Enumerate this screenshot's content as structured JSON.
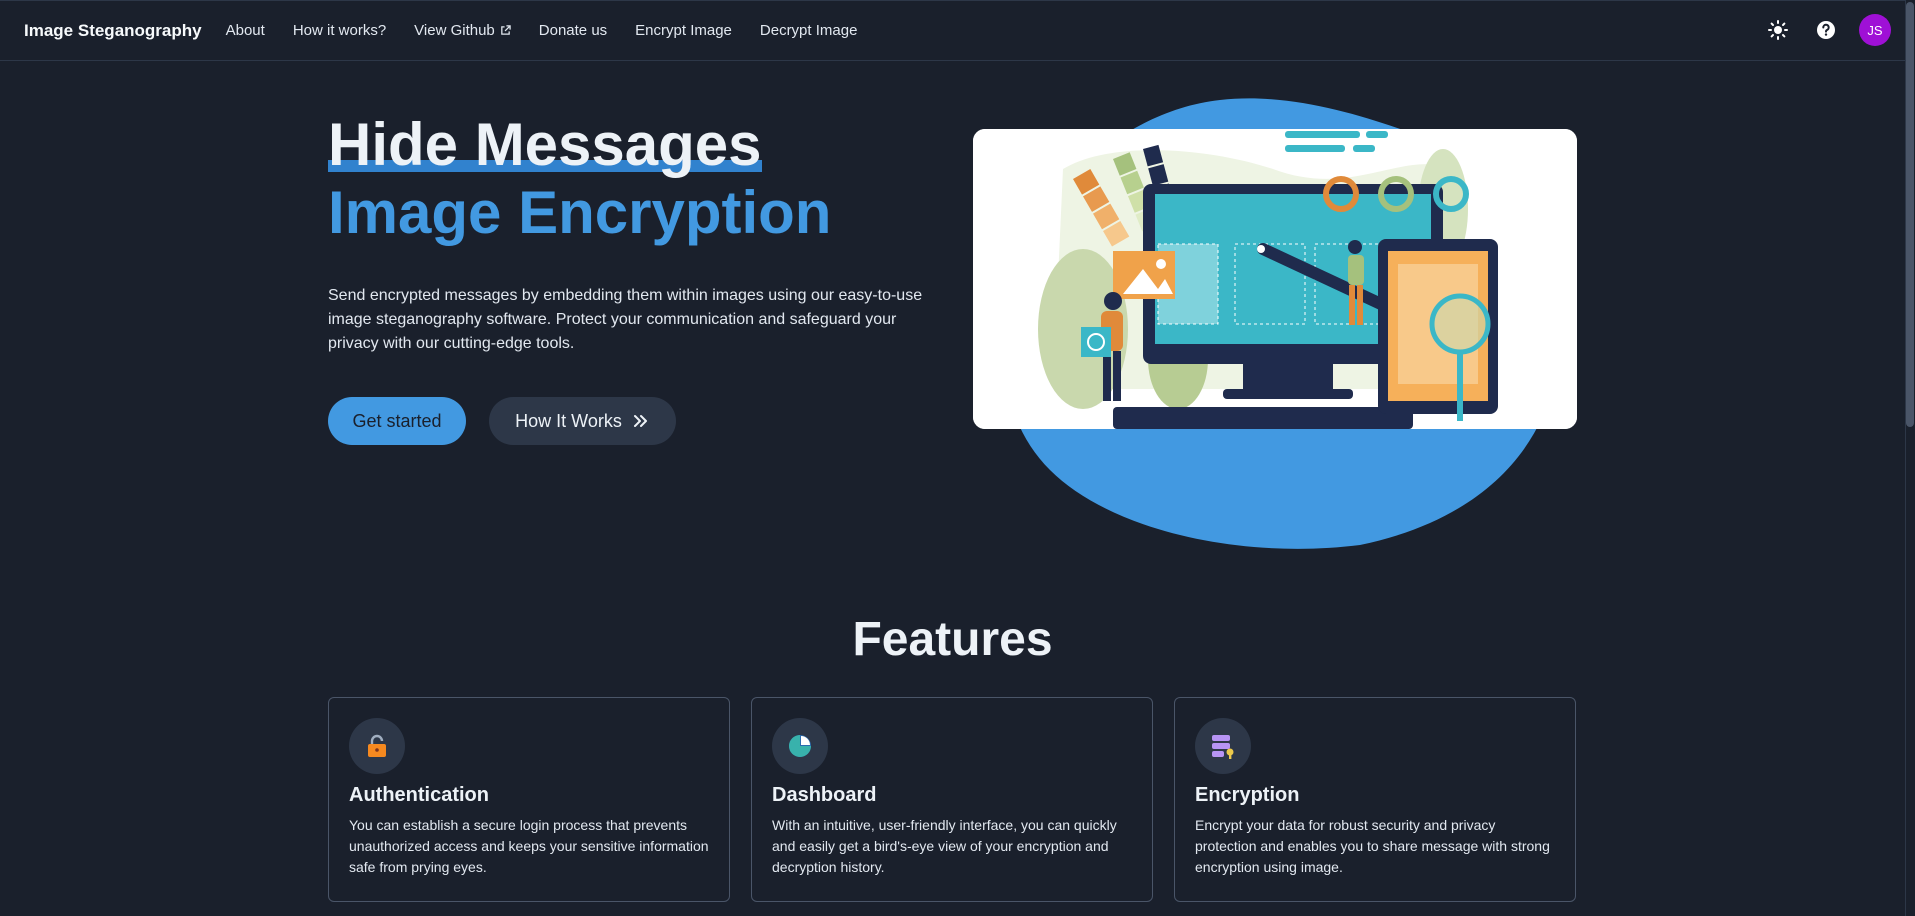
{
  "nav": {
    "brand": "Image Steganography",
    "links": [
      "About",
      "How it works?",
      "View Github",
      "Donate us",
      "Encrypt Image",
      "Decrypt Image"
    ],
    "avatar_initials": "JS"
  },
  "hero": {
    "title_line1": "Hide Messages",
    "title_line2": "Image Encryption",
    "description": "Send encrypted messages by embedding them within images using our easy-to-use image steganography software. Protect your communication and safeguard your privacy with our cutting-edge tools.",
    "primary_button": "Get started",
    "secondary_button": "How It Works"
  },
  "features": {
    "title": "Features",
    "cards": [
      {
        "title": "Authentication",
        "text": "You can establish a secure login process that prevents unauthorized access and keeps your sensitive information safe from prying eyes.",
        "icon": "lock-icon"
      },
      {
        "title": "Dashboard",
        "text": "With an intuitive, user-friendly interface, you can quickly and easily get a bird's-eye view of your encryption and decryption history.",
        "icon": "pie-chart-icon"
      },
      {
        "title": "Encryption",
        "text": "Encrypt your data for robust security and privacy protection and enables you to share message with strong encryption using image.",
        "icon": "database-key-icon"
      }
    ]
  },
  "colors": {
    "background": "#1a202c",
    "accent": "#4299e1",
    "avatar": "#9f10d6"
  }
}
